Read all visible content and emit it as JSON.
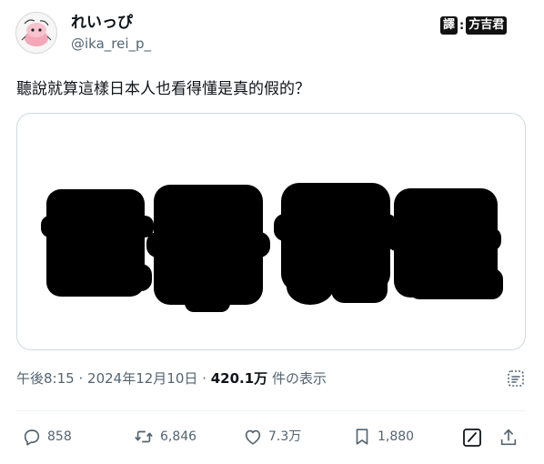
{
  "user": {
    "display_name": "れいっぴ",
    "handle": "@ika_rei_p_"
  },
  "translator": {
    "label": "譯",
    "colon": ":",
    "name": "方吉君"
  },
  "tweet": {
    "text": "聽說就算這樣日本人也看得懂是真的假的？"
  },
  "meta": {
    "time": "午後8:15",
    "sep1": "·",
    "date": "2024年12月10日",
    "sep2": "·",
    "views_count": "420.1万",
    "views_label": "件の表示"
  },
  "actions": {
    "replies": "858",
    "reposts": "6,846",
    "likes": "7.3万",
    "bookmarks": "1,880"
  },
  "colors": {
    "text_primary": "#0f1419",
    "text_secondary": "#536471",
    "border": "#cfd9de"
  },
  "icons": {
    "reply": "reply-icon",
    "repost": "repost-icon",
    "like": "like-icon",
    "bookmark": "bookmark-icon",
    "grok": "grok-icon",
    "edit": "edit-icon",
    "share": "share-icon"
  }
}
